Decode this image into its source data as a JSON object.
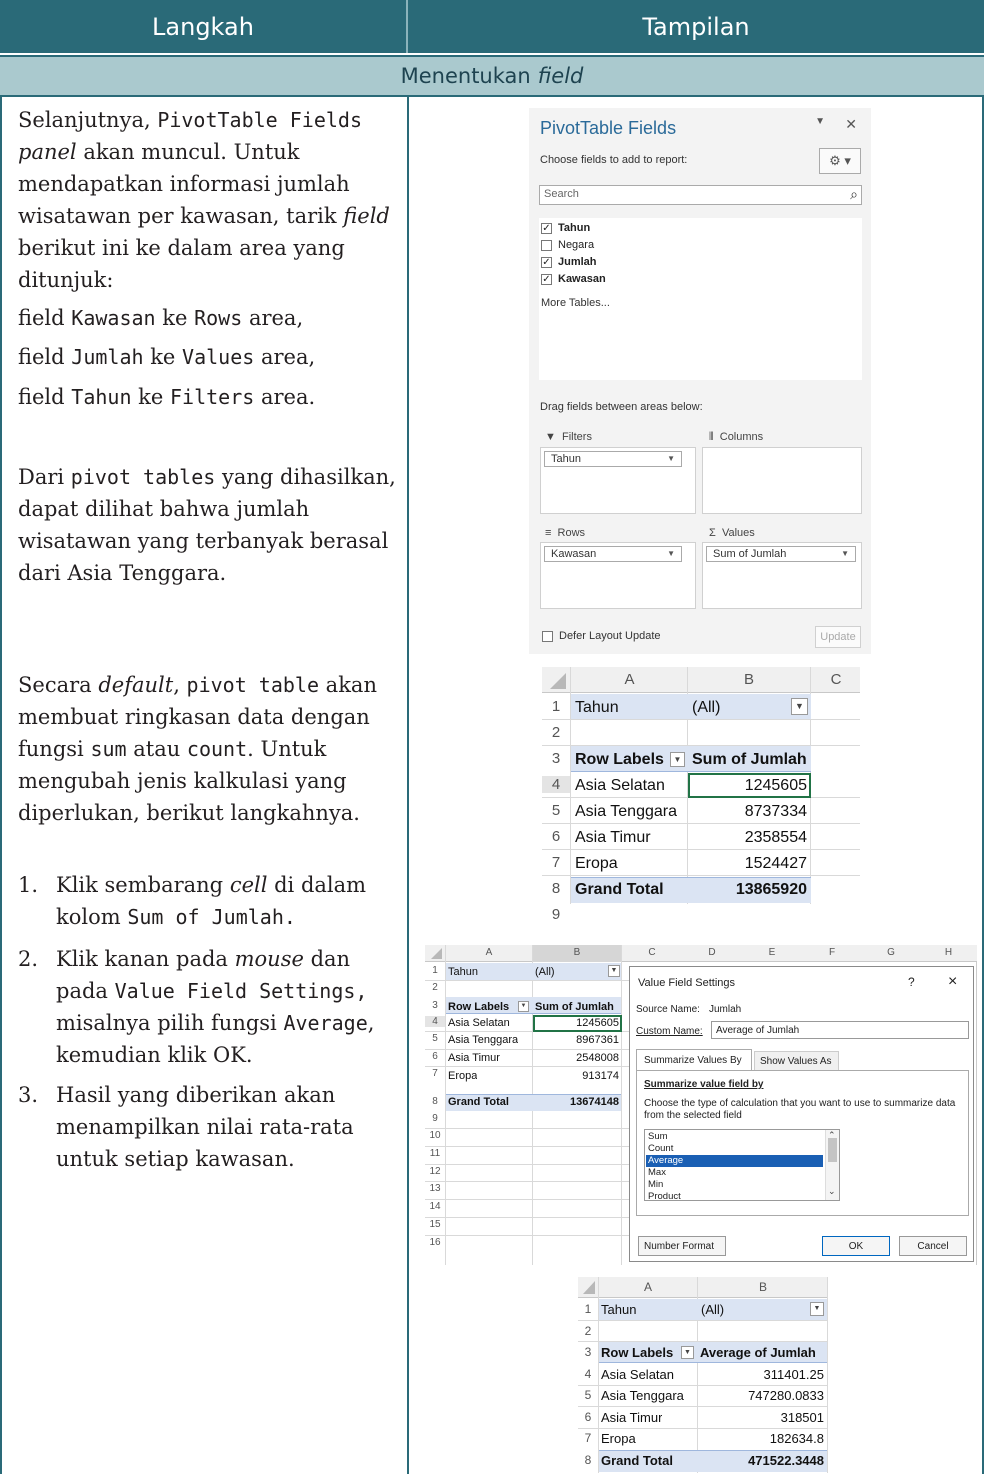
{
  "header": {
    "left": "Langkah",
    "right": "Tampilan"
  },
  "section": {
    "label": "Menentukan",
    "label_em": "field"
  },
  "left": {
    "p1_a": "Selanjutnya, ",
    "p1_code1": "PivotTable Fields",
    "p1_em": "panel",
    "p1_b": " akan muncul. Untuk mendapatkan informasi jumlah wisatawan per kawasan, tarik ",
    "p1_em2": "field",
    "p1_c": " berikut ini ke dalam area yang ditunjuk:",
    "f1_a": "field ",
    "f1_code": "Kawasan",
    "f1_b": " ke ",
    "f1_code2": "Rows",
    "f1_c": " area,",
    "f2_a": "field ",
    "f2_code": "Jumlah",
    "f2_b": " ke ",
    "f2_code2": "Values",
    "f2_c": " area,",
    "f3_a": "field ",
    "f3_code": "Tahun",
    "f3_b": " ke ",
    "f3_code2": "Filters",
    "f3_c": " area.",
    "p2_a": "Dari ",
    "p2_code": "pivot tables",
    "p2_b": " yang dihasilkan, dapat dilihat bahwa jumlah wisatawan yang terbanyak berasal dari Asia Tenggara.",
    "p3_a": "Secara ",
    "p3_em": "default",
    "p3_b": ", ",
    "p3_code": "pivot table",
    "p3_c": " akan membuat ringkasan data dengan fungsi ",
    "p3_code2": "sum",
    "p3_d": " atau ",
    "p3_code3": "count",
    "p3_e": ". Untuk mengubah jenis kalkulasi yang diperlukan, berikut langkahnya.",
    "s1_num": "1.",
    "s1_a": "Klik sembarang ",
    "s1_em": "cell",
    "s1_b": " di dalam kolom ",
    "s1_code": "Sum of Jumlah.",
    "s2_num": "2.",
    "s2_a": "Klik kanan pada ",
    "s2_em": "mouse",
    "s2_b": " dan pada ",
    "s2_code": "Value Field Settings,",
    "s2_c": " misalnya pilih fungsi ",
    "s2_code2": "Average",
    "s2_d": ", kemudian klik OK.",
    "s3_num": "3.",
    "s3_a": "Hasil yang diberikan akan menampilkan nilai rata-rata untuk setiap kawasan."
  },
  "pivot_fields": {
    "title": "PivotTable Fields",
    "choose": "Choose fields to add to report:",
    "search_placeholder": "Search",
    "fields": [
      {
        "name": "Tahun",
        "checked": true
      },
      {
        "name": "Negara",
        "checked": false
      },
      {
        "name": "Jumlah",
        "checked": true
      },
      {
        "name": "Kawasan",
        "checked": true
      }
    ],
    "more_tables": "More Tables...",
    "drag_text": "Drag fields between areas below:",
    "filters_label": "Filters",
    "filters_value": "Tahun",
    "columns_label": "Columns",
    "rows_label": "Rows",
    "rows_value": "Kawasan",
    "values_label": "Values",
    "values_value": "Sum of Jumlah",
    "defer": "Defer Layout Update",
    "update": "Update"
  },
  "sheet1": {
    "cols": [
      "A",
      "B",
      "C"
    ],
    "rows": [
      "1",
      "2",
      "3",
      "4",
      "5",
      "6",
      "7",
      "8",
      "9"
    ],
    "filter_label": "Tahun",
    "filter_value": "(All)",
    "row_labels": "Row Labels",
    "value_header": "Sum of Jumlah",
    "data": [
      {
        "label": "Asia Selatan",
        "value": "1245605"
      },
      {
        "label": "Asia Tenggara",
        "value": "8737334"
      },
      {
        "label": "Asia Timur",
        "value": "2358554"
      },
      {
        "label": "Eropa",
        "value": "1524427"
      }
    ],
    "total_label": "Grand Total",
    "total_value": "13865920"
  },
  "sheet2": {
    "cols": [
      "A",
      "B",
      "C",
      "D",
      "E",
      "F",
      "G",
      "H"
    ],
    "rows": [
      "1",
      "2",
      "3",
      "4",
      "5",
      "6",
      "7",
      "8",
      "9",
      "10",
      "11",
      "12",
      "13",
      "14",
      "15",
      "16"
    ],
    "filter_label": "Tahun",
    "filter_value": "(All)",
    "row_labels": "Row Labels",
    "value_header": "Sum of Jumlah",
    "data": [
      {
        "label": "Asia Selatan",
        "value": "1245605"
      },
      {
        "label": "Asia Tenggara",
        "value": "8967361"
      },
      {
        "label": "Asia Timur",
        "value": "2548008"
      },
      {
        "label": "Eropa",
        "value": "913174"
      }
    ],
    "total_label": "Grand Total",
    "total_value": "13674148"
  },
  "dialog": {
    "title": "Value Field Settings",
    "help": "?",
    "close": "×",
    "source_label": "Source Name:",
    "source_value": "Jumlah",
    "custom_label": "Custom Name:",
    "custom_value": "Average of Jumlah",
    "tab1": "Summarize Values By",
    "tab2": "Show Values As",
    "section": "Summarize value field by",
    "desc": "Choose the type of calculation that you want to use to summarize data from the selected field",
    "options": [
      "Sum",
      "Count",
      "Average",
      "Max",
      "Min",
      "Product"
    ],
    "selected": "Average",
    "number_format": "Number Format",
    "ok": "OK",
    "cancel": "Cancel"
  },
  "sheet3": {
    "cols": [
      "A",
      "B"
    ],
    "rows": [
      "1",
      "2",
      "3",
      "4",
      "5",
      "6",
      "7",
      "8"
    ],
    "filter_label": "Tahun",
    "filter_value": "(All)",
    "row_labels": "Row Labels",
    "value_header": "Average of Jumlah",
    "data": [
      {
        "label": "Asia Selatan",
        "value": "311401.25"
      },
      {
        "label": "Asia Tenggara",
        "value": "747280.0833"
      },
      {
        "label": "Asia Timur",
        "value": "318501"
      },
      {
        "label": "Eropa",
        "value": "182634.8"
      }
    ],
    "total_label": "Grand Total",
    "total_value": "471522.3448"
  }
}
